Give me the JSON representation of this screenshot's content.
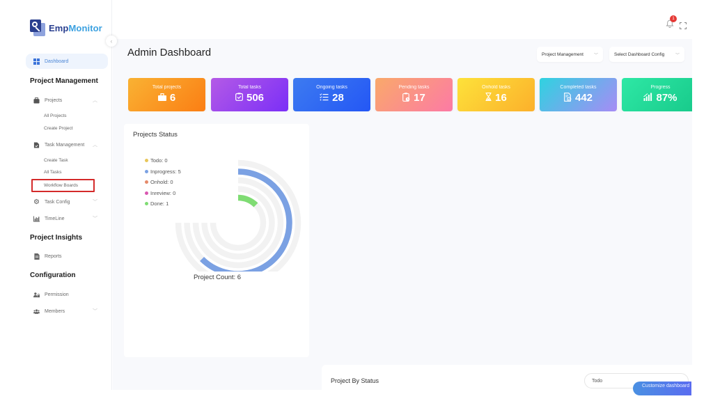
{
  "brand": {
    "name_part1": "Emp",
    "name_part2": "Monitor"
  },
  "header": {
    "page_title": "Admin Dashboard",
    "notification_count": "1",
    "selects": [
      {
        "value": "Project Management"
      },
      {
        "value": "Select Dashboard Config"
      }
    ]
  },
  "sidebar": {
    "dashboard_label": "Dashboard",
    "sections": {
      "project_management": "Project Management",
      "project_insights": "Project Insights",
      "configuration": "Configuration"
    },
    "items": {
      "projects": "Projects",
      "all_projects": "All Projects",
      "create_project": "Create Project",
      "task_management": "Task Management",
      "create_task": "Create Task",
      "all_tasks": "All Tasks",
      "workflow_boards": "Workflow Boards",
      "task_config": "Task Config",
      "timeline": "TimeLine",
      "reports": "Reports",
      "permission": "Permission",
      "members": "Members"
    }
  },
  "cards": [
    {
      "label": "Total projects",
      "value": "6",
      "icon": "briefcase-icon",
      "gradient": [
        "#f9b233",
        "#fb7e14"
      ]
    },
    {
      "label": "Total tasks",
      "value": "506",
      "icon": "checkbox-icon",
      "gradient": [
        "#b45ae6",
        "#7b2ff7"
      ]
    },
    {
      "label": "Ongoing tasks",
      "value": "28",
      "icon": "checklist-icon",
      "gradient": [
        "#3d7bf0",
        "#2457f5"
      ]
    },
    {
      "label": "Pending tasks",
      "value": "17",
      "icon": "clipboard-clock-icon",
      "gradient": [
        "#f9a96a",
        "#fc7aa5"
      ]
    },
    {
      "label": "Onhold tasks",
      "value": "16",
      "icon": "hourglass-icon",
      "gradient": [
        "#fde23a",
        "#fcb02b"
      ]
    },
    {
      "label": "Completed tasks",
      "value": "442",
      "icon": "document-check-icon",
      "gradient": [
        "#2ed3e0",
        "#a78bf5"
      ]
    },
    {
      "label": "Progress",
      "value": "87%",
      "icon": "signal-bars-icon",
      "gradient": [
        "#2ee8a5",
        "#17c98a"
      ]
    }
  ],
  "projects_status": {
    "title": "Projects Status",
    "count_label": "Project Count: 6"
  },
  "chart_data": {
    "type": "radialBar",
    "title": "Projects Status",
    "total": 6,
    "annotation": "Project Count: 6",
    "legend_position": "top-left",
    "categories": [
      "Todo",
      "Inprogress",
      "Onhold",
      "Inreview",
      "Done"
    ],
    "values": [
      0,
      5,
      0,
      0,
      1
    ],
    "colors": [
      "#e8c65a",
      "#7ba1e3",
      "#e58a6a",
      "#d957b0",
      "#7fdc73"
    ],
    "legend_labels": [
      "Todo: 0",
      "Inprogress: 5",
      "Onhold: 0",
      "Inreview: 0",
      "Done: 1"
    ],
    "max": 6,
    "sweep_degrees": 270
  },
  "project_by_status": {
    "title": "Project By Status",
    "filter_value": "Todo",
    "customize_label": "Customize dashboard"
  }
}
